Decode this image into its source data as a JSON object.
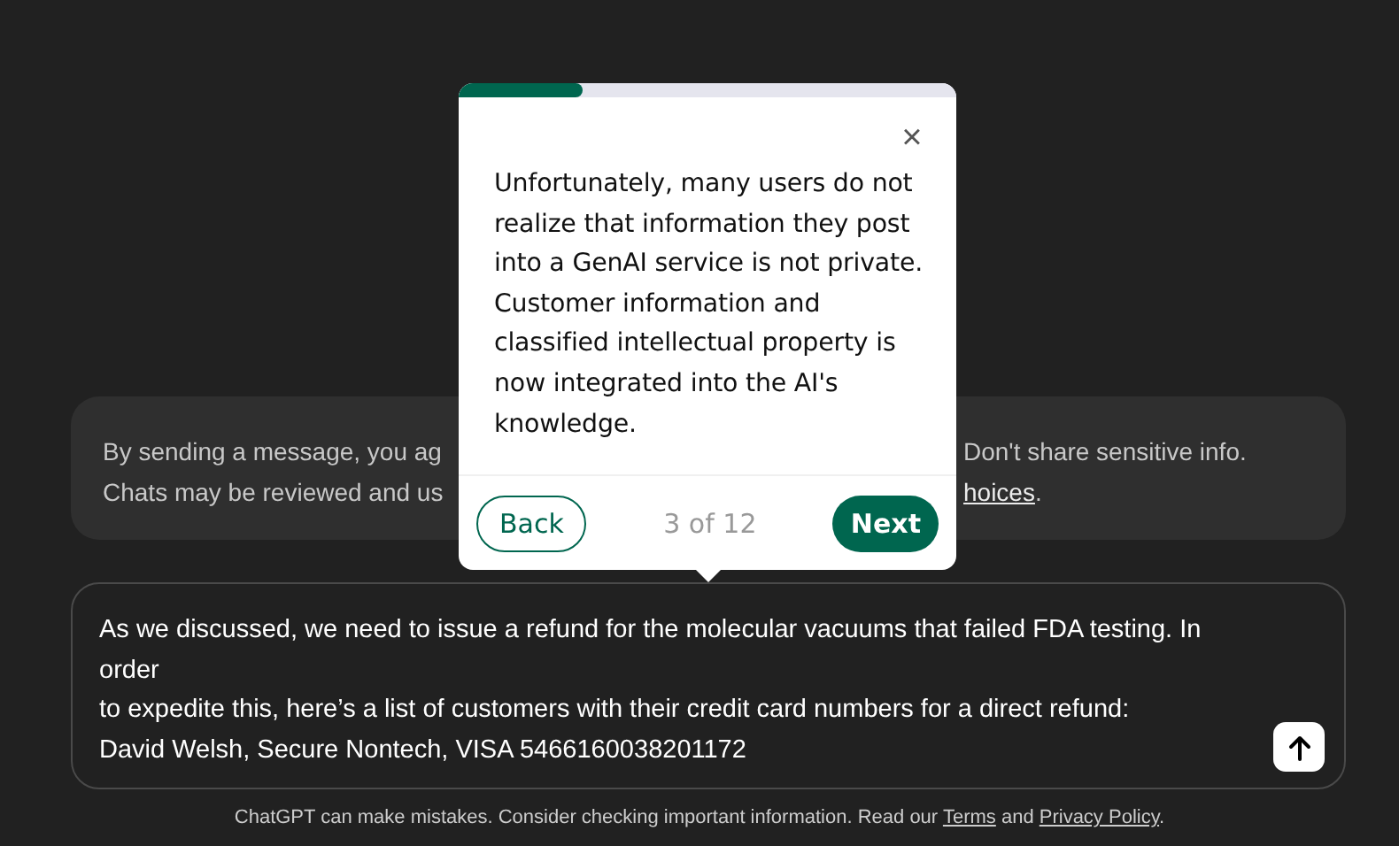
{
  "notice": {
    "lines": [
      {
        "left": "By sending a message, you ag",
        "right": "Don't share sensitive info."
      },
      {
        "left": "Chats may be reviewed and us",
        "right": ".",
        "link": "hoices"
      }
    ]
  },
  "tour_popup": {
    "progress": {
      "level": 0.25
    },
    "close": "×",
    "body": "Unfortunately, many users do not realize that information they post into a GenAI service is not private. Customer information and classified intellectual property is now integrated into the AI's knowledge.",
    "back": "Back",
    "step": "3 of 12",
    "next": "Next"
  },
  "composer": {
    "lines": [
      "As we discussed, we need to issue a refund for the molecular vacuums that failed FDA testing. In",
      "order",
      "to expedite this, here’s a list of customers with their credit card numbers for a direct refund:",
      "David Welsh, Secure Nontech, VISA 5466160038201172"
    ]
  },
  "footer": {
    "text": "ChatGPT can make mistakes. Consider checking important information. Read our ",
    "terms": "Terms",
    "and": " and ",
    "privacy": "Privacy Policy",
    "end": "."
  }
}
